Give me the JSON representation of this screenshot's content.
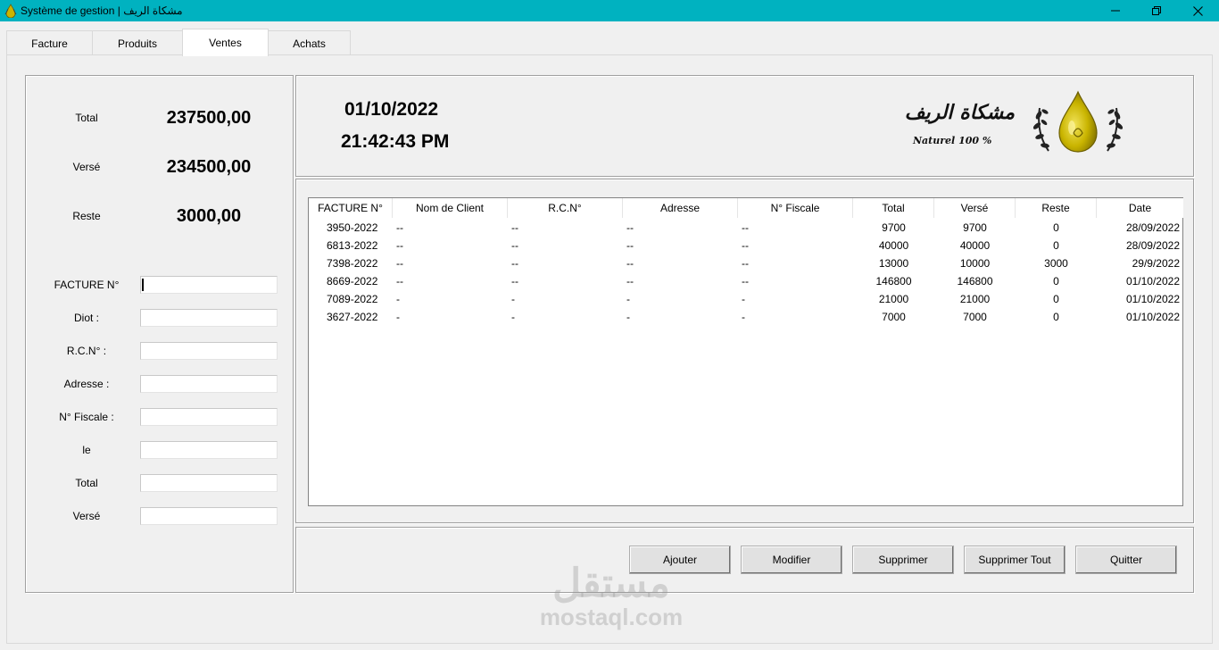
{
  "window": {
    "title": "Système de gestion | مشكاة الريف",
    "title_color": "#00b2c0"
  },
  "tabs": [
    {
      "label": "Facture",
      "active": false
    },
    {
      "label": "Produits",
      "active": false
    },
    {
      "label": "Ventes",
      "active": true
    },
    {
      "label": "Achats",
      "active": false
    }
  ],
  "summary": {
    "total_label": "Total",
    "total_value": "237500,00",
    "verse_label": "Versé",
    "verse_value": "234500,00",
    "reste_label": "Reste",
    "reste_value": "3000,00"
  },
  "form": {
    "fields": [
      {
        "label": "FACTURE N°",
        "value": ""
      },
      {
        "label": "Diot :",
        "value": ""
      },
      {
        "label": "R.C.N° :",
        "value": ""
      },
      {
        "label": "Adresse :",
        "value": ""
      },
      {
        "label": "N° Fiscale :",
        "value": ""
      },
      {
        "label": "le",
        "value": ""
      },
      {
        "label": "Total",
        "value": ""
      },
      {
        "label": "Versé",
        "value": ""
      }
    ]
  },
  "header": {
    "date": "01/10/2022",
    "time": "21:42:43 PM",
    "logo_text_ar": "مشكاة الريف",
    "logo_text_lat": "Naturel 100 %",
    "logo_color": "#c9b400"
  },
  "table": {
    "columns": [
      "FACTURE N°",
      "Nom de Client",
      "R.C.N°",
      "Adresse",
      "N° Fiscale",
      "Total",
      "Versé",
      "Reste",
      "Date"
    ],
    "rows": [
      [
        "3950-2022",
        "--",
        "--",
        "--",
        "--",
        "9700",
        "9700",
        "0",
        "28/09/2022"
      ],
      [
        "6813-2022",
        "--",
        "--",
        "--",
        "--",
        "40000",
        "40000",
        "0",
        "28/09/2022"
      ],
      [
        "7398-2022",
        "--",
        "--",
        "--",
        "--",
        "13000",
        "10000",
        "3000",
        "29/9/2022"
      ],
      [
        "8669-2022",
        "--",
        "--",
        "--",
        "--",
        "146800",
        "146800",
        "0",
        "01/10/2022"
      ],
      [
        "7089-2022",
        "-",
        "-",
        "-",
        "-",
        "21000",
        "21000",
        "0",
        "01/10/2022"
      ],
      [
        "3627-2022",
        "-",
        "-",
        "-",
        "-",
        "7000",
        "7000",
        "0",
        "01/10/2022"
      ]
    ]
  },
  "buttons": {
    "add": "Ajouter",
    "modify": "Modifier",
    "delete": "Supprimer",
    "delete_all": "Supprimer Tout",
    "quit": "Quitter"
  },
  "watermark": {
    "ar": "مستقل",
    "lat": "mostaql.com"
  }
}
